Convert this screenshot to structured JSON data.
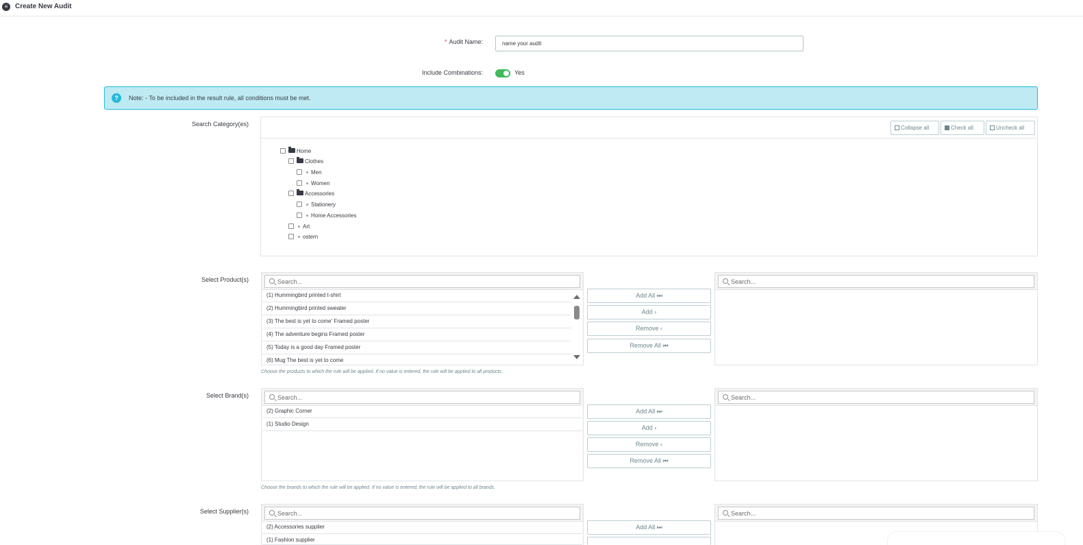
{
  "header": {
    "icon": "list-circle-icon",
    "title": "Create New Audit"
  },
  "audit_name": {
    "required_mark": "*",
    "label": "Audit Name:",
    "value": "name your audit"
  },
  "include_combinations": {
    "label": "Include Combinations:",
    "state": "Yes",
    "enabled": true
  },
  "note": {
    "text": "Note: - To be included in the result rule, all conditions must be met.",
    "icon": "question-icon"
  },
  "category": {
    "label": "Search Category(es)",
    "buttons": {
      "collapse": "Collapse all",
      "check": "Check all",
      "uncheck": "Uncheck all"
    },
    "tree": [
      {
        "label": "Home",
        "type": "folder"
      },
      {
        "label": "Clothes",
        "type": "folder"
      },
      {
        "label": "Men",
        "type": "leaf"
      },
      {
        "label": "Women",
        "type": "leaf"
      },
      {
        "label": "Accessories",
        "type": "folder"
      },
      {
        "label": "Stationery",
        "type": "leaf"
      },
      {
        "label": "Home Accessories",
        "type": "leaf"
      },
      {
        "label": "Art",
        "type": "leaf"
      },
      {
        "label": "ostern",
        "type": "leaf"
      }
    ]
  },
  "search_placeholder": "Search...",
  "move_buttons": {
    "add_all": "Add All ⏭",
    "add": "Add ›",
    "remove": "Remove ‹",
    "remove_all": "Remove All ⏮"
  },
  "products": {
    "label": "Select Product(s)",
    "items": [
      "(1) Hummingbird printed t-shirt",
      "(2) Hummingbird printed sweater",
      "(3) The best is yet to come' Framed poster",
      "(4) The adventure begins Framed poster",
      "(5) Today is a good day Framed poster",
      "(6) Mug The best is yet to come"
    ],
    "help": "Choose the products to which the rule will be applied. If no value is entered, the rule will be applied to all products."
  },
  "brands": {
    "label": "Select Brand(s)",
    "items": [
      "(2) Graphic Corner",
      "(1) Studio Design"
    ],
    "help": "Choose the brands to which the rule will be applied. If no value is entered, the rule will be applied to all brands."
  },
  "suppliers": {
    "label": "Select Supplier(s)",
    "items": [
      "(2) Accessories supplier",
      "(1) Fashion supplier"
    ]
  }
}
